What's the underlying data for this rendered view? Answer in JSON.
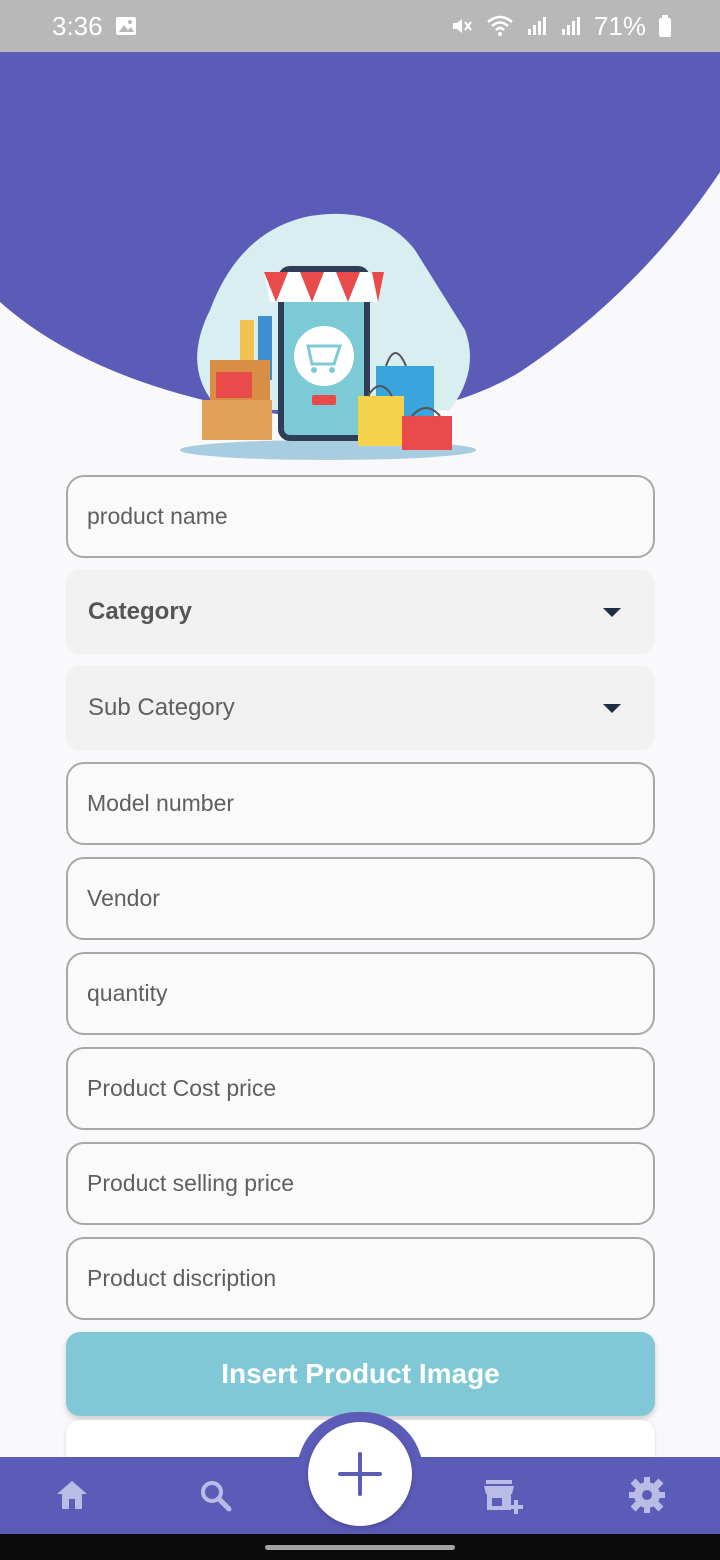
{
  "status_bar": {
    "time": "3:36",
    "battery": "71%"
  },
  "form": {
    "product_name_placeholder": "product name",
    "category_label": "Category",
    "sub_category_label": "Sub Category",
    "model_number_placeholder": "Model number",
    "vendor_placeholder": "Vendor",
    "quantity_placeholder": "quantity",
    "cost_price_placeholder": "Product Cost price",
    "selling_price_placeholder": "Product selling price",
    "description_placeholder": "Product discription",
    "insert_image_label": "Insert Product Image"
  },
  "colors": {
    "accent": "#5b5cb8",
    "button": "#80c8d6",
    "status_bar": "#b8b8b8"
  },
  "icons": {
    "nav_home": "home-icon",
    "nav_search": "search-icon",
    "fab": "plus-icon",
    "nav_store_add": "add-store-icon",
    "nav_settings": "gear-icon"
  }
}
